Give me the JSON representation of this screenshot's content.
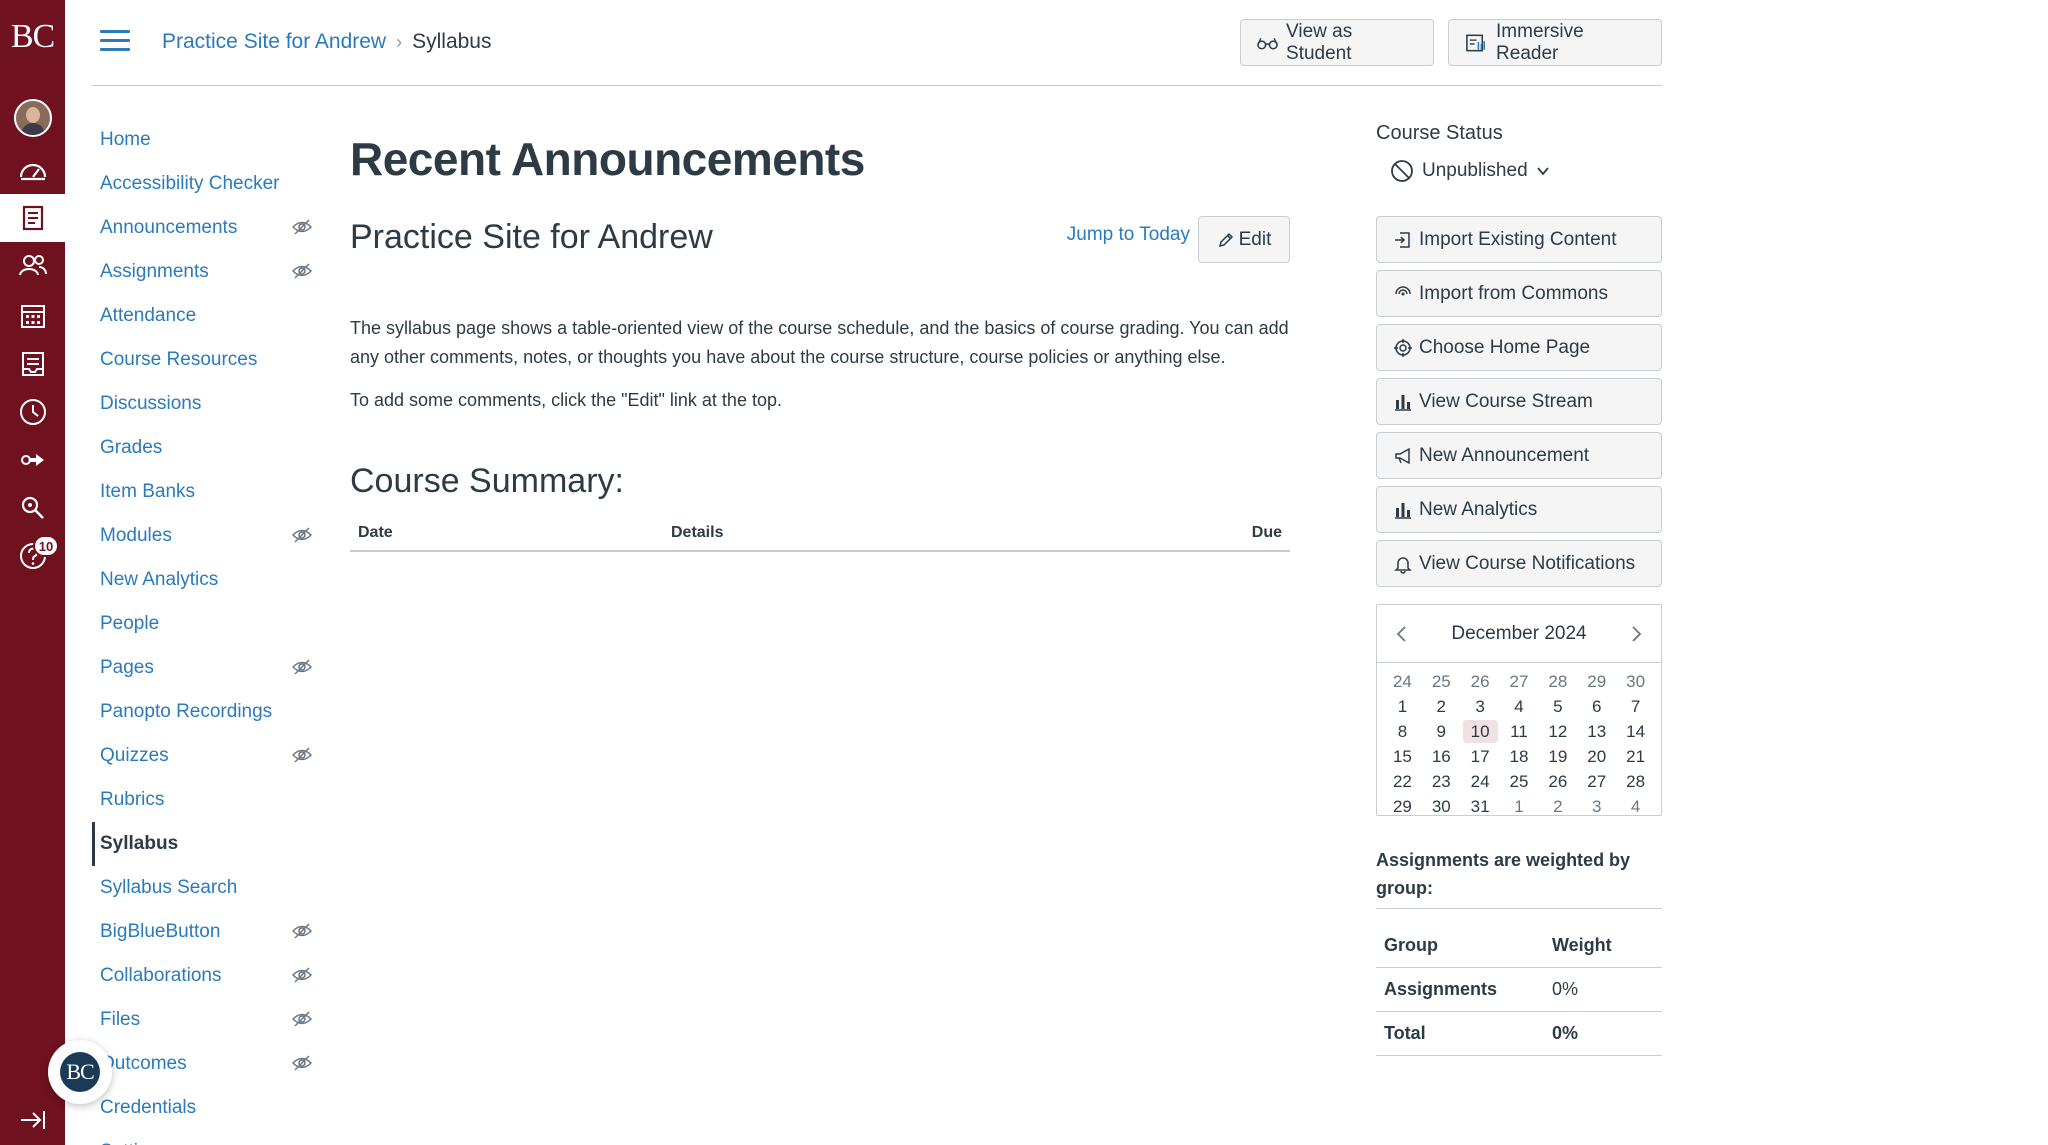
{
  "global_nav": {
    "logo": "BC",
    "items": [
      "account",
      "dashboard",
      "courses",
      "groups",
      "calendar",
      "inbox",
      "history",
      "commons",
      "search",
      "help"
    ],
    "help_badge": "10"
  },
  "header": {
    "breadcrumb_course": "Practice Site for Andrew",
    "breadcrumb_separator": "›",
    "breadcrumb_current": "Syllabus",
    "view_as_student": "View as Student",
    "immersive_reader": "Immersive Reader"
  },
  "course_nav": {
    "items": [
      {
        "label": "Home",
        "hidden": false
      },
      {
        "label": "Accessibility Checker",
        "hidden": false
      },
      {
        "label": "Announcements",
        "hidden": true
      },
      {
        "label": "Assignments",
        "hidden": true
      },
      {
        "label": "Attendance",
        "hidden": false
      },
      {
        "label": "Course Resources",
        "hidden": false
      },
      {
        "label": "Discussions",
        "hidden": false
      },
      {
        "label": "Grades",
        "hidden": false
      },
      {
        "label": "Item Banks",
        "hidden": false
      },
      {
        "label": "Modules",
        "hidden": true
      },
      {
        "label": "New Analytics",
        "hidden": false
      },
      {
        "label": "People",
        "hidden": false
      },
      {
        "label": "Pages",
        "hidden": true
      },
      {
        "label": "Panopto Recordings",
        "hidden": false
      },
      {
        "label": "Quizzes",
        "hidden": true
      },
      {
        "label": "Rubrics",
        "hidden": false
      },
      {
        "label": "Syllabus",
        "hidden": false,
        "active": true
      },
      {
        "label": "Syllabus Search",
        "hidden": false
      },
      {
        "label": "BigBlueButton",
        "hidden": true
      },
      {
        "label": "Collaborations",
        "hidden": true
      },
      {
        "label": "Files",
        "hidden": true
      },
      {
        "label": "Outcomes",
        "hidden": true
      },
      {
        "label": "Credentials",
        "hidden": false
      },
      {
        "label": "Settings",
        "hidden": false
      }
    ]
  },
  "main": {
    "title": "Recent Announcements",
    "course_name": "Practice Site for Andrew",
    "jump_to_today": "Jump to Today",
    "edit": "Edit",
    "body_p1": "The syllabus page shows a table-oriented view of the course schedule, and the basics of course grading. You can add any other comments, notes, or thoughts you have about the course structure, course policies or anything else.",
    "body_p2": "To add some comments, click the \"Edit\" link at the top.",
    "summary_title": "Course Summary:",
    "summary_headers": {
      "date": "Date",
      "details": "Details",
      "due": "Due"
    }
  },
  "sidebar": {
    "course_status_label": "Course Status",
    "status_value": "Unpublished",
    "buttons": [
      {
        "label": "Import Existing Content",
        "icon": "import-icon"
      },
      {
        "label": "Import from Commons",
        "icon": "commons-icon"
      },
      {
        "label": "Choose Home Page",
        "icon": "target-icon"
      },
      {
        "label": "View Course Stream",
        "icon": "bar-chart-icon"
      },
      {
        "label": "New Announcement",
        "icon": "megaphone-icon"
      },
      {
        "label": "New Analytics",
        "icon": "bar-chart-icon"
      },
      {
        "label": "View Course Notifications",
        "icon": "bell-icon"
      }
    ],
    "calendar": {
      "month": "December 2024",
      "today": "10",
      "weeks": [
        [
          "24",
          "25",
          "26",
          "27",
          "28",
          "29",
          "30"
        ],
        [
          "1",
          "2",
          "3",
          "4",
          "5",
          "6",
          "7"
        ],
        [
          "8",
          "9",
          "10",
          "11",
          "12",
          "13",
          "14"
        ],
        [
          "15",
          "16",
          "17",
          "18",
          "19",
          "20",
          "21"
        ],
        [
          "22",
          "23",
          "24",
          "25",
          "26",
          "27",
          "28"
        ],
        [
          "29",
          "30",
          "31",
          "1",
          "2",
          "3",
          "4"
        ]
      ]
    },
    "weights_title": "Assignments are weighted by group:",
    "weights": {
      "header": {
        "group": "Group",
        "weight": "Weight"
      },
      "rows": [
        {
          "group": "Assignments",
          "weight": "0%"
        },
        {
          "group": "Total",
          "weight": "0%"
        }
      ]
    }
  },
  "float_badge": "BC",
  "colors": {
    "brand": "#70111f",
    "link": "#2b7abc",
    "text": "#2d3b45",
    "border": "#c7cdd1",
    "today_bg": "#f1e1e3"
  }
}
